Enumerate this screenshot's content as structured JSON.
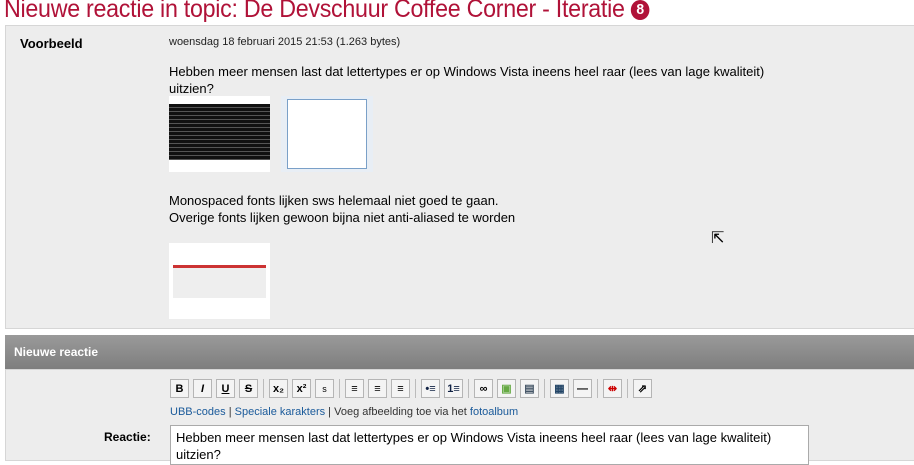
{
  "title": "Nieuwe reactie in topic: De Devschuur Coffee Corner - Iteratie",
  "title_badge": "8",
  "preview": {
    "label": "Voorbeeld",
    "meta": "woensdag 18 februari 2015 21:53 (1.263 bytes)",
    "para1": "Hebben meer mensen last dat lettertypes er op Windows Vista ineens heel raar (lees van lage kwaliteit) uitzien?",
    "para2": "Monospaced fonts lijken sws helemaal niet goed te gaan.",
    "para3": "Overige fonts lijken gewoon bijna niet anti-aliased te worden"
  },
  "section_title": "Nieuwe reactie",
  "toolbar": [
    "B",
    "I",
    "U",
    "S",
    "x₂",
    "x²",
    "s",
    "≡",
    "≡",
    "≡",
    "•≡",
    "1≡",
    "∞",
    "▣",
    "▤",
    "▦",
    "—",
    "⇹",
    "⇗"
  ],
  "links": {
    "ubb": "UBB-codes",
    "special": "Speciale karakters",
    "sep": " | ",
    "album_text": "Voeg afbeelding toe via het ",
    "album_link": "fotoalbum"
  },
  "reply_label": "Reactie:",
  "reply_value": "Hebben meer mensen last dat lettertypes er op Windows Vista ineens heel raar (lees van lage kwaliteit) uitzien?"
}
